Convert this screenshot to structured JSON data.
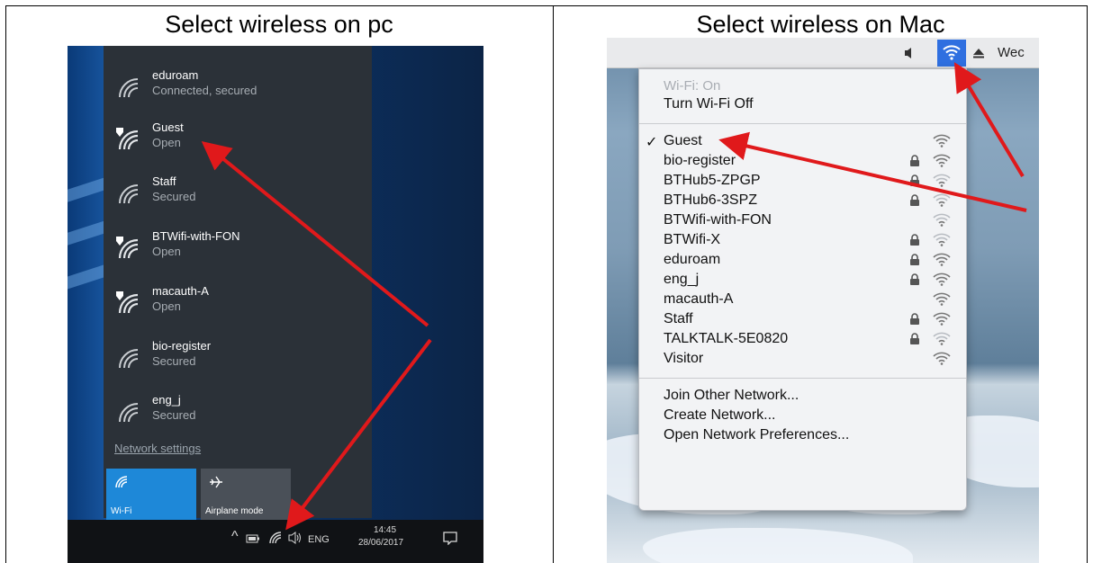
{
  "titles": {
    "pc": "Select wireless on pc",
    "mac": "Select wireless on Mac"
  },
  "windows": {
    "networks": [
      {
        "name": "eduroam",
        "status": "Connected, secured",
        "shield": false
      },
      {
        "name": "Guest",
        "status": "Open",
        "shield": true
      },
      {
        "name": "Staff",
        "status": "Secured",
        "shield": false
      },
      {
        "name": "BTWifi-with-FON",
        "status": "Open",
        "shield": true
      },
      {
        "name": "macauth-A",
        "status": "Open",
        "shield": true
      },
      {
        "name": "bio-register",
        "status": "Secured",
        "shield": false
      },
      {
        "name": "eng_j",
        "status": "Secured",
        "shield": false
      }
    ],
    "network_settings": "Network settings",
    "tiles": [
      {
        "label": "Wi-Fi",
        "active": true
      },
      {
        "label": "Airplane mode",
        "active": false
      }
    ],
    "taskbar": {
      "caret": "^",
      "language": "ENG",
      "time": "14:45",
      "date": "28/06/2017"
    }
  },
  "mac": {
    "menubar_day": "Wec",
    "wifi_status": "Wi-Fi: On",
    "turn_off": "Turn Wi-Fi Off",
    "check": "✓",
    "networks": [
      {
        "name": "Guest",
        "locked": false,
        "checked": true
      },
      {
        "name": "bio-register",
        "locked": true,
        "checked": false
      },
      {
        "name": "BTHub5-ZPGP",
        "locked": true,
        "checked": false
      },
      {
        "name": "BTHub6-3SPZ",
        "locked": true,
        "checked": false
      },
      {
        "name": "BTWifi-with-FON",
        "locked": false,
        "checked": false
      },
      {
        "name": "BTWifi-X",
        "locked": true,
        "checked": false
      },
      {
        "name": "eduroam",
        "locked": true,
        "checked": false
      },
      {
        "name": "eng_j",
        "locked": true,
        "checked": false
      },
      {
        "name": "macauth-A",
        "locked": false,
        "checked": false
      },
      {
        "name": "Staff",
        "locked": true,
        "checked": false
      },
      {
        "name": "TALKTALK-5E0820",
        "locked": true,
        "checked": false
      },
      {
        "name": "Visitor",
        "locked": false,
        "checked": false
      }
    ],
    "join_other": "Join Other Network...",
    "create_network": "Create Network...",
    "open_prefs": "Open Network Preferences..."
  },
  "colors": {
    "arrow": "#e0191b",
    "win_flyout": "#2b3138",
    "win_tile_active": "#1e88d8",
    "mac_highlight": "#2f6fe0"
  }
}
